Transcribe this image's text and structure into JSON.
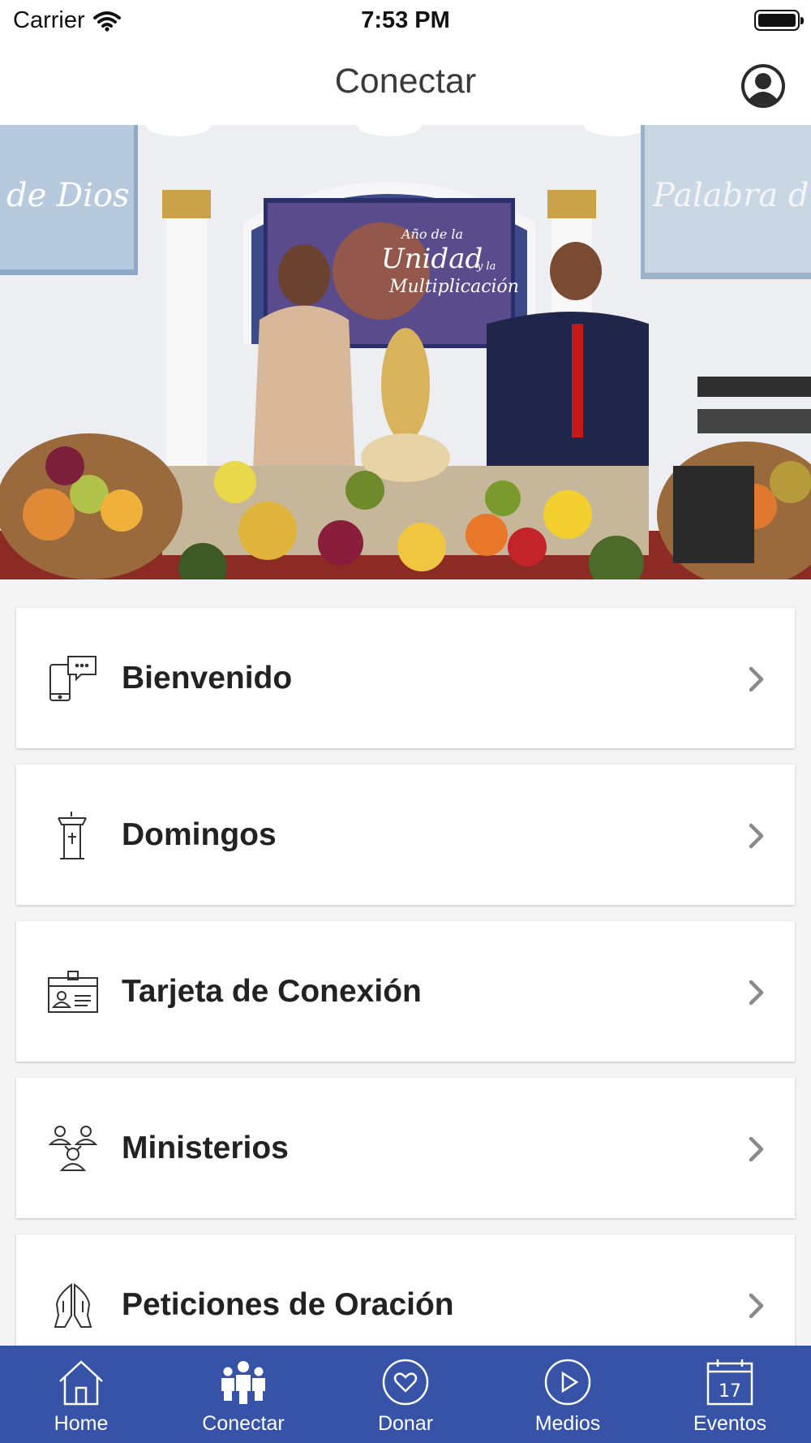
{
  "status_bar": {
    "carrier": "Carrier",
    "time": "7:53 PM"
  },
  "nav": {
    "title": "Conectar",
    "profile_icon": "person-circle-icon"
  },
  "hero": {
    "banner_left_text": "de Dios",
    "banner_center_line1": "Año de la",
    "banner_center_line2": "Unidad",
    "banner_center_line3": "y la",
    "banner_center_line4": "Multiplicación",
    "banner_right_text": "Palabra d"
  },
  "menu": {
    "items": [
      {
        "label": "Bienvenido",
        "icon": "phone-chat-icon"
      },
      {
        "label": "Domingos",
        "icon": "pulpit-icon"
      },
      {
        "label": "Tarjeta de Conexión",
        "icon": "id-card-icon"
      },
      {
        "label": "Ministerios",
        "icon": "people-group-icon"
      },
      {
        "label": "Peticiones de Oración",
        "icon": "praying-hands-icon"
      }
    ]
  },
  "tab_bar": {
    "accent": "#3653a8",
    "tabs": [
      {
        "label": "Home",
        "icon": "home-icon"
      },
      {
        "label": "Conectar",
        "icon": "people-icon"
      },
      {
        "label": "Donar",
        "icon": "heart-circle-icon"
      },
      {
        "label": "Medios",
        "icon": "play-circle-icon"
      },
      {
        "label": "Eventos",
        "icon": "calendar-icon",
        "day": "17"
      }
    ]
  }
}
